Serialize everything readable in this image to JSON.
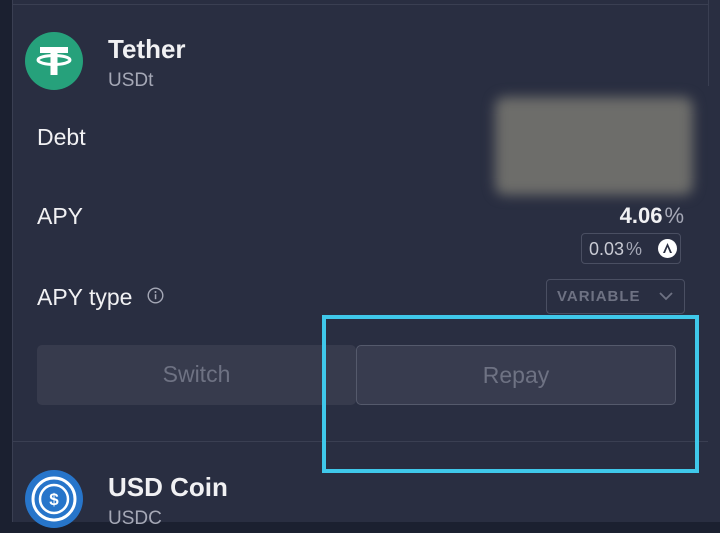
{
  "colors": {
    "tether_green": "#26a17b",
    "usdc_blue": "#2775ca",
    "highlight_cyan": "#3fc8ea"
  },
  "tether": {
    "name": "Tether",
    "symbol": "USDt",
    "icon": "tether-icon",
    "debt_label": "Debt",
    "apy_label": "APY",
    "apy_value": "4.06",
    "apy_unit": "%",
    "incentive_value": "0.03",
    "incentive_unit": "%",
    "incentive_icon": "aave-icon",
    "apy_type_label": "APY type",
    "apy_type_selected": "VARIABLE",
    "switch_label": "Switch",
    "repay_label": "Repay"
  },
  "usdc": {
    "name": "USD Coin",
    "symbol": "USDC",
    "icon": "usdc-icon"
  }
}
